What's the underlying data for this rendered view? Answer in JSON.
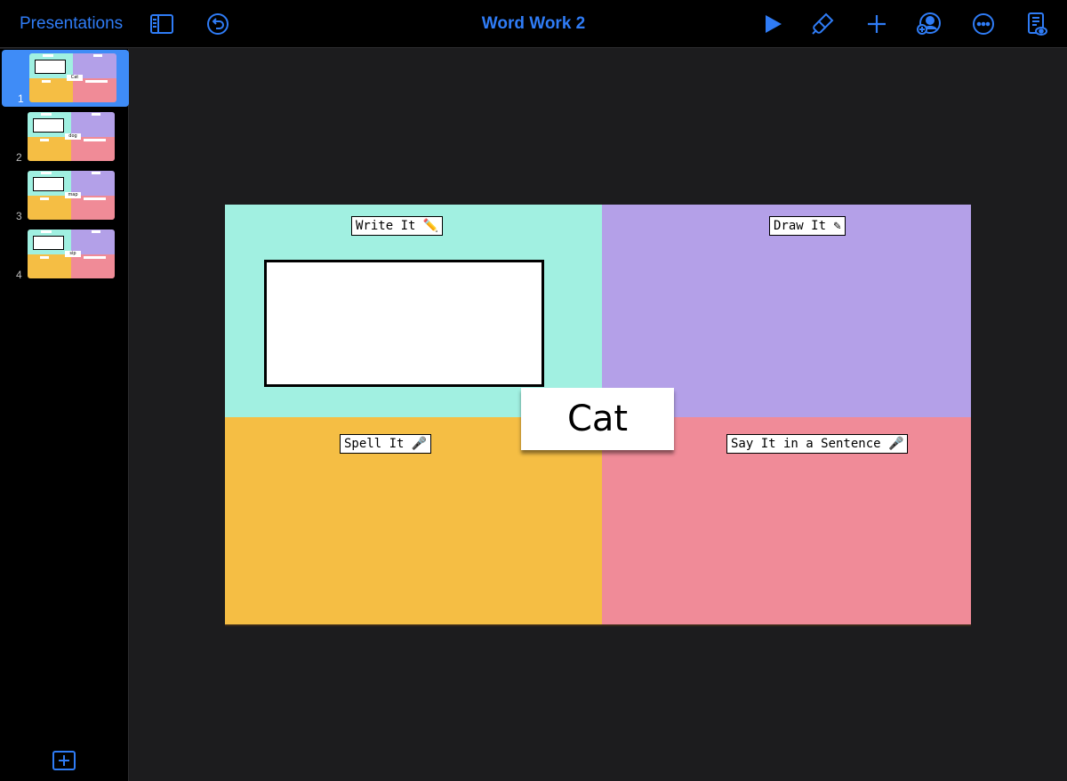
{
  "toolbar": {
    "back_label": "Presentations",
    "title": "Word Work 2",
    "icons": [
      "sidebar-toggle-icon",
      "undo-icon",
      "play-icon",
      "format-brush-icon",
      "add-icon",
      "collaborate-icon",
      "more-icon",
      "reader-view-icon"
    ],
    "accent_color": "#2f7cf6"
  },
  "sidebar": {
    "slides": [
      {
        "number": "1",
        "word": "Cat",
        "selected": true
      },
      {
        "number": "2",
        "word": "dog",
        "selected": false
      },
      {
        "number": "3",
        "word": "map",
        "selected": false
      },
      {
        "number": "4",
        "word": "sip",
        "selected": false
      }
    ],
    "add_slide_icon": "add-slide-icon"
  },
  "slide": {
    "labels": {
      "write": "Write It ✏️",
      "draw": "Draw It ✎",
      "spell": "Spell It 🎤",
      "sentence": "Say It in a Sentence 🎤"
    },
    "word": "Cat",
    "colors": {
      "write": "#a1f0e1",
      "draw": "#b4a0e8",
      "spell": "#f5be44",
      "sentence": "#f08b98"
    }
  }
}
